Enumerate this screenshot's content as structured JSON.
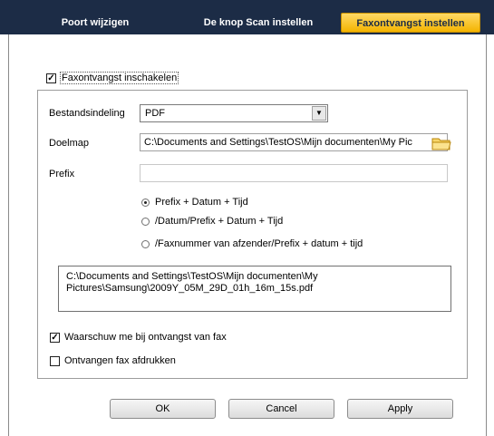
{
  "tabs": [
    {
      "label": "Poort wijzigen"
    },
    {
      "label": "De knop Scan instellen"
    },
    {
      "label": "Faxontvangst instellen"
    }
  ],
  "enable": {
    "label": "Faxontvangst inschakelen",
    "checked": true
  },
  "form": {
    "format_label": "Bestandsindeling",
    "format_value": "PDF",
    "dest_label": "Doelmap",
    "dest_value": "C:\\Documents and Settings\\TestOS\\Mijn documenten\\My Pic",
    "prefix_label": "Prefix",
    "prefix_value": ""
  },
  "radios": [
    {
      "label": "Prefix + Datum + Tijd",
      "selected": true
    },
    {
      "label": "/Datum/Prefix + Datum + Tijd",
      "selected": false
    },
    {
      "label": "/Faxnummer van afzender/Prefix + datum + tijd",
      "selected": false
    }
  ],
  "path_preview": {
    "line1": "C:\\Documents and Settings\\TestOS\\Mijn documenten\\My",
    "line2": "Pictures\\Samsung\\2009Y_05M_29D_01h_16m_15s.pdf"
  },
  "options": {
    "warn_label": "Waarschuw me bij ontvangst van fax",
    "warn_checked": true,
    "print_label": "Ontvangen fax afdrukken",
    "print_checked": false
  },
  "buttons": {
    "ok": "OK",
    "cancel": "Cancel",
    "apply": "Apply"
  },
  "colors": {
    "tabbar": "#1c2c46",
    "active_tab": "#f4b400"
  }
}
